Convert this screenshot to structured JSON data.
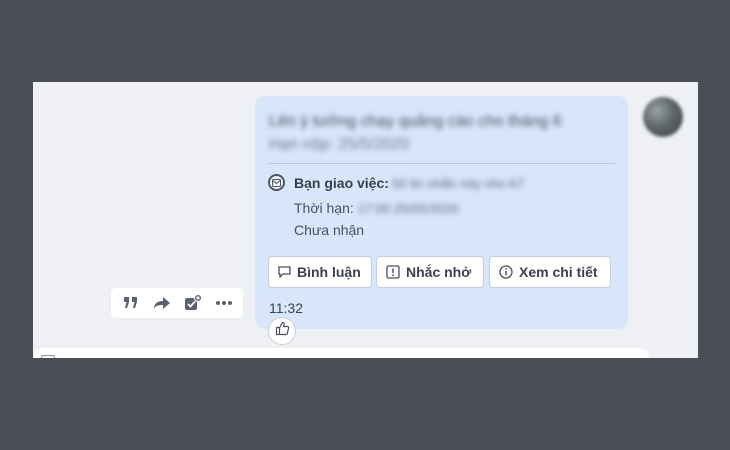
{
  "message": {
    "title": "Lên ý tưởng chạy quảng cáo cho tháng 6",
    "deadline": "Hạn nộp: 25/5/2020",
    "assign_label": "Bạn giao việc:",
    "assign_value": "50 tin nhắn này cho A7",
    "deadline_label": "Thời hạn:",
    "deadline_value": "17:00 25/05/2020",
    "status": "Chưa nhận",
    "time": "11:32"
  },
  "buttons": {
    "comment": "Bình luận",
    "remind": "Nhắc nhở",
    "detail": "Xem chi tiết"
  },
  "icons": {
    "task": "task-checkbox-icon",
    "comment": "comment-icon",
    "remind": "exclamation-icon",
    "detail": "info-icon",
    "like": "thumbs-up-icon",
    "quote": "quote-icon",
    "forward": "forward-icon",
    "add_task": "add-task-icon",
    "more": "more-icon"
  },
  "colors": {
    "card_bg": "#d8e6fb",
    "frame_bg": "#4b4e54",
    "panel_bg": "#eef0f3"
  }
}
